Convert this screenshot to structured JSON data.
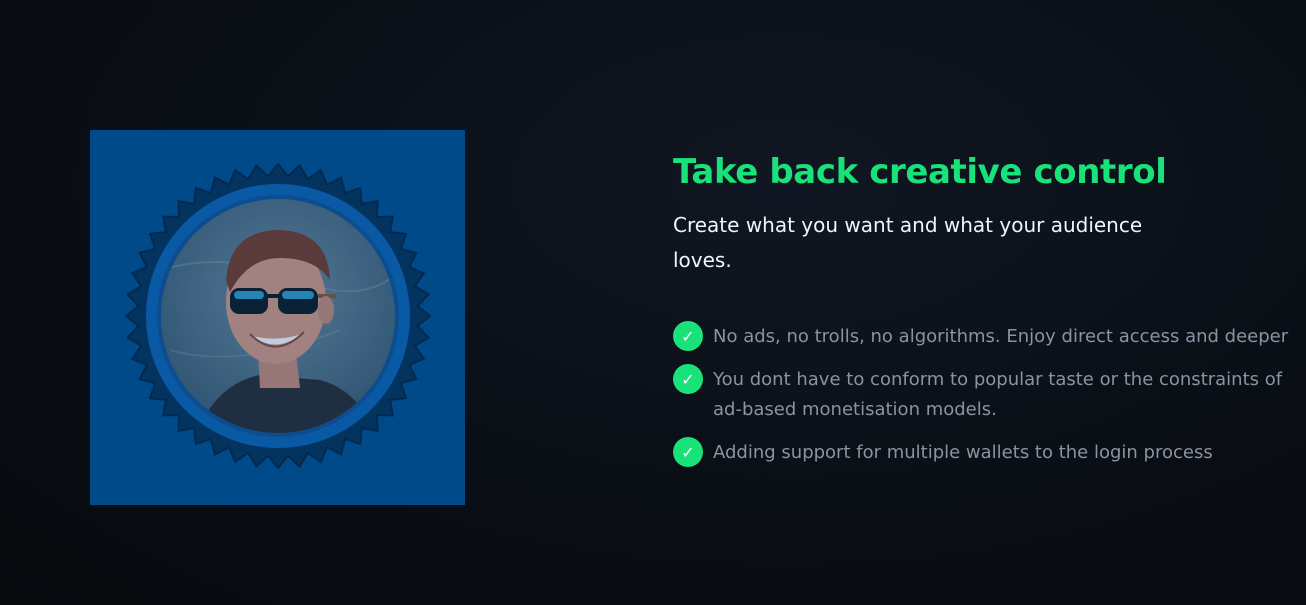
{
  "feature": {
    "headline": "Take back creative control",
    "subhead": "Create what you want and what your audience loves.",
    "image": {
      "description_icon": "creator-avatar-icon",
      "frame_color": "#004a8a"
    },
    "bullets": [
      {
        "icon": "check-icon",
        "text": "No ads, no trolls, no algorithms. Enjoy direct access and deeper"
      },
      {
        "icon": "check-icon",
        "text": "You dont have to conform to popular taste or the constraints of ad-based monetisation models."
      },
      {
        "icon": "check-icon",
        "text": "Adding support for multiple wallets to the login process"
      }
    ],
    "check_glyph": "✓"
  },
  "colors": {
    "accent": "#19e27a",
    "background": "#0a0e15",
    "subhead": "#eaf7ff",
    "bullet_text": "#8a93a1"
  }
}
